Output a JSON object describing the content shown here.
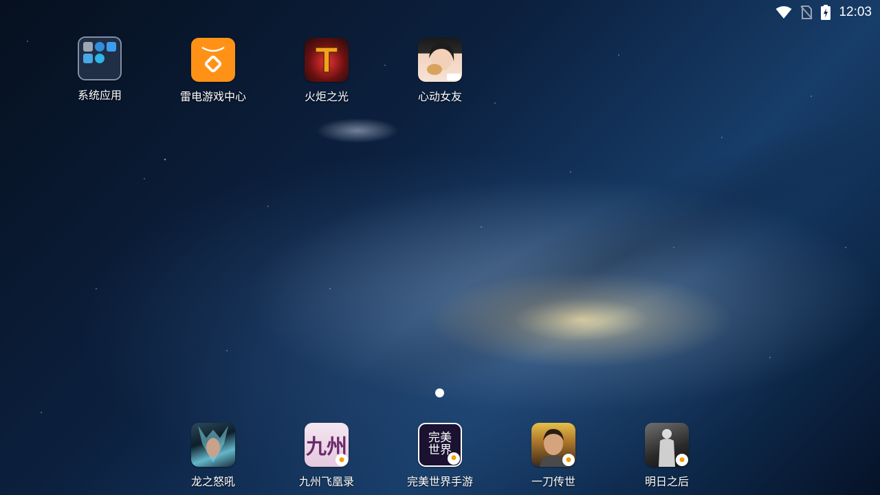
{
  "status_bar": {
    "time": "12:03",
    "icons": [
      "wifi-icon",
      "no-sim-icon",
      "battery-charging-icon"
    ]
  },
  "desktop": {
    "apps": [
      {
        "label": "系统应用",
        "icon": "system-apps-folder-icon"
      },
      {
        "label": "雷电游戏中心",
        "icon": "leidian-game-center-icon"
      },
      {
        "label": "火炬之光",
        "icon": "torchlight-icon"
      },
      {
        "label": "心动女友",
        "icon": "xindong-girlfriend-icon"
      }
    ],
    "folder_mini_icons": [
      "settings-icon",
      "browser-icon",
      "files-icon",
      "contacts-icon",
      "downloads-icon"
    ]
  },
  "page_indicator": {
    "current": 1,
    "total": 1
  },
  "dock": {
    "apps": [
      {
        "label": "龙之怒吼",
        "icon": "dragon-roar-icon"
      },
      {
        "label": "九州飞凰录",
        "icon": "jiuzhou-icon",
        "tile_text": "九州"
      },
      {
        "label": "完美世界手游",
        "icon": "perfect-world-icon",
        "tile_text": "完美世界"
      },
      {
        "label": "一刀传世",
        "icon": "yidao-chuanshi-icon"
      },
      {
        "label": "明日之后",
        "icon": "lifeafter-icon"
      }
    ]
  },
  "colors": {
    "leidian_orange": "#ff9216",
    "text": "#ffffff"
  }
}
